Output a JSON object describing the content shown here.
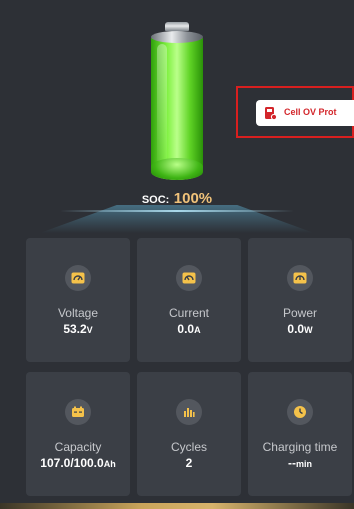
{
  "soc": {
    "label": "SOC:",
    "value": "100%",
    "level": 1.0
  },
  "alarm": {
    "text": "Cell OV Prot",
    "icon": "battery-alert-icon",
    "color": "#d3262b"
  },
  "cards": {
    "voltage": {
      "label": "Voltage",
      "value": "53.2",
      "unit": "V",
      "icon": "gauge-icon"
    },
    "current": {
      "label": "Current",
      "value": "0.0",
      "unit": "A",
      "icon": "gauge-icon"
    },
    "power": {
      "label": "Power",
      "value": "0.0",
      "unit": "W",
      "icon": "gauge-icon"
    },
    "capacity": {
      "label": "Capacity",
      "value": "107.0/100.0",
      "unit": "Ah",
      "icon": "battery-icon"
    },
    "cycles": {
      "label": "Cycles",
      "value": "2",
      "unit": "",
      "icon": "bar-chart-icon"
    },
    "charging_time": {
      "label": "Charging time",
      "value": "--",
      "unit": "min",
      "icon": "clock-icon"
    }
  },
  "colors": {
    "accent": "#f0c27a",
    "icon": "#f5c24a",
    "card": "#3b3f46",
    "background": "#2d3036"
  }
}
